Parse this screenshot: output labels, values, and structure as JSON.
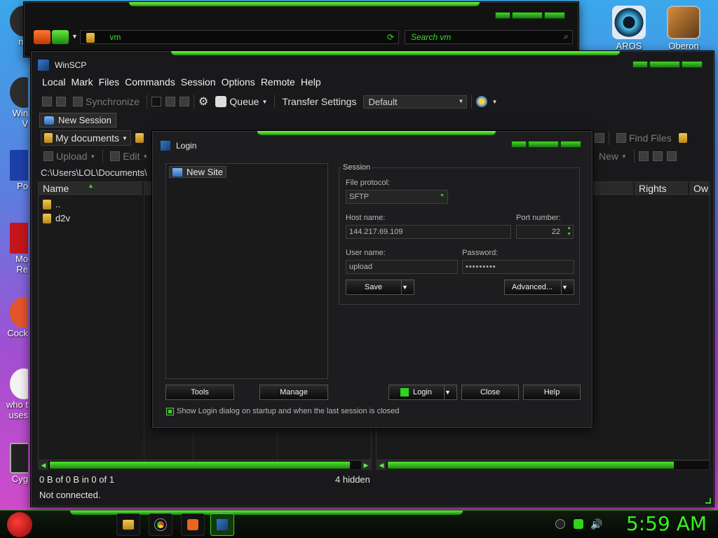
{
  "desktop": {
    "icons_right": [
      {
        "label": "AROS"
      },
      {
        "label": "Oberon"
      }
    ],
    "icons_left_partial": [
      "mi",
      "Win\nV",
      "Po",
      "Mo\nRe",
      "Cock",
      "who t\nuses",
      "Cyg"
    ]
  },
  "explorer": {
    "address": "vm",
    "search_placeholder": "Search vm"
  },
  "winscp": {
    "title": "WinSCP",
    "menu": [
      "Local",
      "Mark",
      "Files",
      "Commands",
      "Session",
      "Options",
      "Remote",
      "Help"
    ],
    "toolbar": {
      "synchronize": "Synchronize",
      "queue": "Queue",
      "transfer_settings": "Transfer Settings",
      "transfer_value": "Default"
    },
    "tab_new_session": "New Session",
    "left_panel": {
      "location": "My documents",
      "upload": "Upload",
      "edit": "Edit",
      "path": "C:\\Users\\LOL\\Documents\\",
      "col_name": "Name",
      "files": [
        "..",
        "d2v"
      ]
    },
    "right_panel": {
      "find_files": "Find Files",
      "new": "New",
      "col_rights": "Rights",
      "col_owner": "Ow"
    },
    "status": {
      "selection": "0 B of 0 B in 0 of 1",
      "hidden": "4 hidden",
      "connection": "Not connected."
    }
  },
  "login": {
    "title": "Login",
    "tree_item": "New Site",
    "session_legend": "Session",
    "file_protocol_label": "File protocol:",
    "file_protocol_value": "SFTP",
    "host_label": "Host name:",
    "host_value": "144.217.69.109",
    "port_label": "Port number:",
    "port_value": "22",
    "user_label": "User name:",
    "user_value": "upload",
    "password_label": "Password:",
    "password_value": "•••••••••",
    "save": "Save",
    "advanced": "Advanced...",
    "tools": "Tools",
    "manage": "Manage",
    "login": "Login",
    "close": "Close",
    "help": "Help",
    "show_on_startup": "Show Login dialog on startup and when the last session is closed"
  },
  "taskbar": {
    "clock": "5:59 AM"
  },
  "colors": {
    "accent_green": "#38f01f",
    "window_bg": "#1c1c1e"
  }
}
